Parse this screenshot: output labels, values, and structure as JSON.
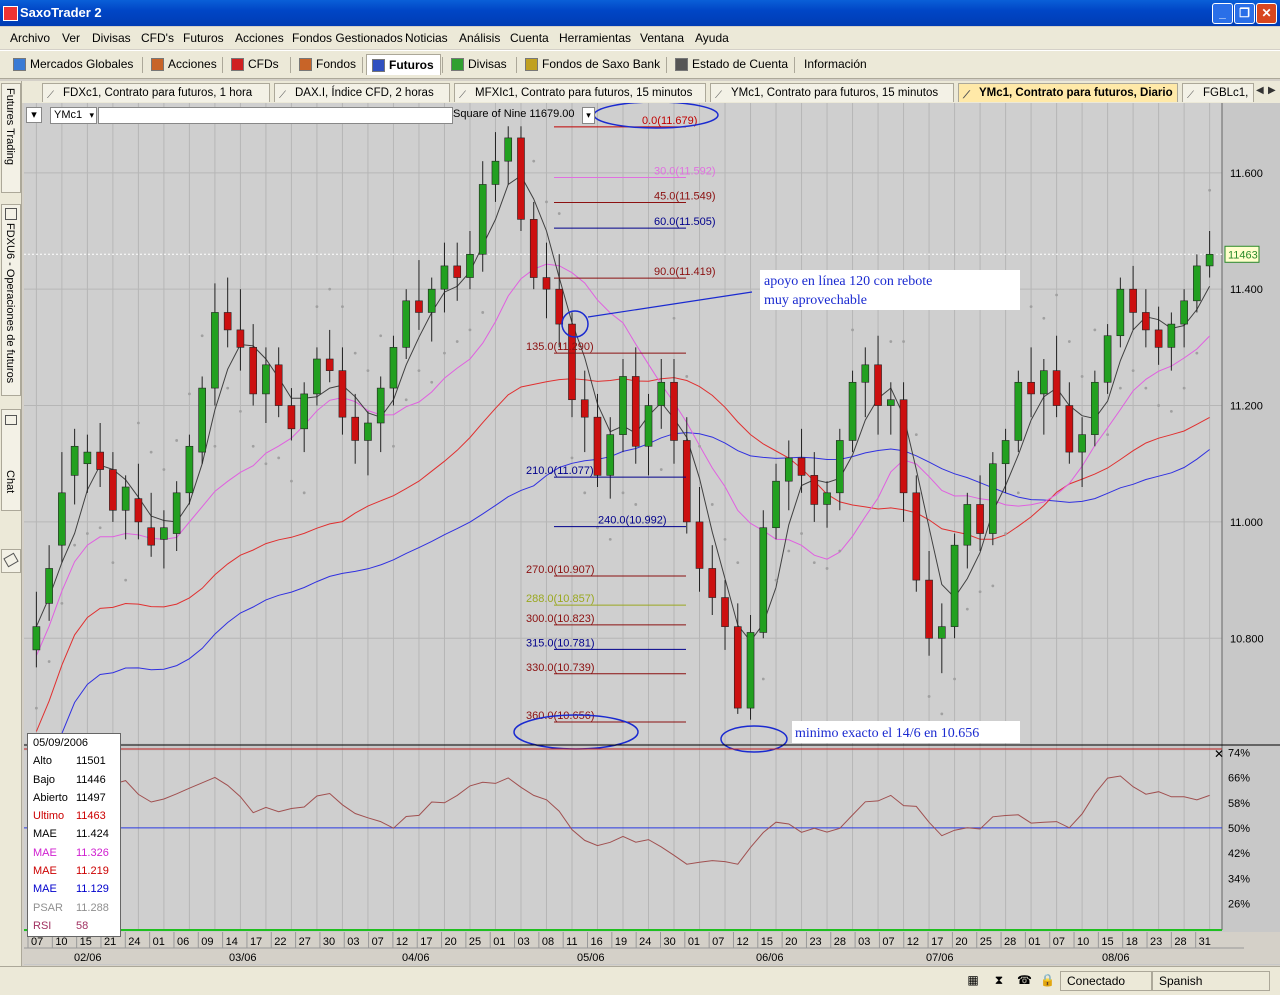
{
  "window": {
    "title": "SaxoTrader 2",
    "min_symbol": "_",
    "max_symbol": "❐",
    "close_symbol": "✕"
  },
  "menu": [
    "Archivo",
    "Ver",
    "Divisas",
    "CFD's",
    "Futuros",
    "Acciones",
    "Fondos Gestionados",
    "Noticias",
    "Análisis",
    "Cuenta",
    "Herramientas",
    "Ventana",
    "Ayuda"
  ],
  "nav": [
    {
      "label": "Mercados Globales",
      "icon": "globe-icon",
      "active": false
    },
    {
      "label": "Acciones",
      "icon": "stocks-icon",
      "active": false
    },
    {
      "label": "CFDs",
      "icon": "cfd-icon",
      "active": false
    },
    {
      "label": "Fondos",
      "icon": "funds-icon",
      "active": false
    },
    {
      "label": "Futuros",
      "icon": "futures-icon",
      "active": true
    },
    {
      "label": "Divisas",
      "icon": "fx-icon",
      "active": false
    },
    {
      "label": "Fondos de Saxo Bank",
      "icon": "saxo-funds-icon",
      "active": false
    },
    {
      "label": "Estado de Cuenta",
      "icon": "account-icon",
      "active": false
    },
    {
      "label": "Información",
      "icon": "",
      "active": false
    }
  ],
  "tabs": [
    {
      "label": "FDXc1, Contrato para futuros, 1 hora",
      "active": false
    },
    {
      "label": "DAX.I, Índice CFD, 2 horas",
      "active": false
    },
    {
      "label": "MFXIc1, Contrato para futuros, 15 minutos",
      "active": false
    },
    {
      "label": "YMc1, Contrato para futuros, 15 minutos",
      "active": false
    },
    {
      "label": "YMc1, Contrato para futuros, Diario",
      "active": true
    },
    {
      "label": "FGBLc1,",
      "active": false
    }
  ],
  "side_tabs": [
    "Futures Trading",
    "FDXU6 - Operaciones de futuros",
    "Chat"
  ],
  "chart_toolbar": {
    "symbol": "YMc1",
    "indicator": "Square of Nine 11679.00"
  },
  "price_label": "11463",
  "y_axis": [
    "11.600",
    "11.400",
    "11.200",
    "11.000",
    "10.800"
  ],
  "rsi_axis": [
    "74%",
    "66%",
    "58%",
    "50%",
    "42%",
    "34%",
    "26%"
  ],
  "square_levels": [
    {
      "label": "0.0(11.679)",
      "color": "#c00000"
    },
    {
      "label": "30.0(11.592)",
      "color": "#e070e0"
    },
    {
      "label": "45.0(11.549)",
      "color": "#8b1010"
    },
    {
      "label": "60.0(11.505)",
      "color": "#00008b"
    },
    {
      "label": "90.0(11.419)",
      "color": "#8b1010"
    },
    {
      "label": "135.0(11.290)",
      "color": "#8b1010"
    },
    {
      "label": "210.0(11.077)",
      "color": "#00008b"
    },
    {
      "label": "240.0(10.992)",
      "color": "#00008b"
    },
    {
      "label": "270.0(10.907)",
      "color": "#8b1010"
    },
    {
      "label": "288.0(10.857)",
      "color": "#9aa820"
    },
    {
      "label": "300.0(10.823)",
      "color": "#8b1010"
    },
    {
      "label": "315.0(10.781)",
      "color": "#00008b"
    },
    {
      "label": "330.0(10.739)",
      "color": "#8b1010"
    },
    {
      "label": "360.0(10.656)",
      "color": "#8b1010"
    }
  ],
  "annotations": {
    "support": "apoyo en línea 120 con rebote muy aprovechable",
    "minimum": "minimo exacto el 14/6 en 10.656"
  },
  "info": {
    "date": "05/09/2006",
    "rows": [
      {
        "label": "Alto",
        "value": "11501",
        "color": "#000000"
      },
      {
        "label": "Bajo",
        "value": "11446",
        "color": "#000000"
      },
      {
        "label": "Abierto",
        "value": "11497",
        "color": "#000000"
      },
      {
        "label": "Ultimo",
        "value": "11463",
        "color": "#cc0000"
      },
      {
        "label": "MAE",
        "value": "11.424",
        "color": "#000000"
      },
      {
        "label": "MAE",
        "value": "11.326",
        "color": "#d020d0"
      },
      {
        "label": "MAE",
        "value": "11.219",
        "color": "#cc0000"
      },
      {
        "label": "MAE",
        "value": "11.129",
        "color": "#0000cc"
      },
      {
        "label": "PSAR",
        "value": "11.288",
        "color": "#909090"
      },
      {
        "label": "RSI",
        "value": "58",
        "color": "#a03060"
      }
    ]
  },
  "x_days": [
    "07",
    "10",
    "15",
    "21",
    "24",
    "01",
    "06",
    "09",
    "14",
    "17",
    "22",
    "27",
    "30",
    "03",
    "07",
    "12",
    "17",
    "20",
    "25",
    "01",
    "03",
    "08",
    "11",
    "16",
    "19",
    "24",
    "30",
    "01",
    "07",
    "12",
    "15",
    "20",
    "23",
    "28",
    "03",
    "07",
    "12",
    "17",
    "20",
    "25",
    "28",
    "01",
    "07",
    "10",
    "15",
    "18",
    "23",
    "28",
    "31"
  ],
  "x_months": [
    "02/06",
    "03/06",
    "04/06",
    "05/06",
    "06/06",
    "07/06",
    "08/06"
  ],
  "status": {
    "connection": "Conectado",
    "language": "Spanish"
  },
  "colors": {
    "up": "#22a020",
    "down": "#cc1010",
    "ma_fast": "#404040",
    "ma_pink": "#e060e0",
    "ma_red": "#e03030",
    "ma_blue": "#3030e0",
    "psar": "#a0a0a0",
    "rsi": "#a05050"
  },
  "chart_data": {
    "type": "candlestick",
    "title": "YMc1, Contrato para futuros, Diario",
    "ylim": [
      10.62,
      11.72
    ],
    "ohlc": [
      [
        10.78,
        10.88,
        10.75,
        10.82
      ],
      [
        10.86,
        10.96,
        10.83,
        10.92
      ],
      [
        10.96,
        11.12,
        10.93,
        11.05
      ],
      [
        11.08,
        11.16,
        11.03,
        11.13
      ],
      [
        11.1,
        11.15,
        11.05,
        11.12
      ],
      [
        11.12,
        11.17,
        11.06,
        11.09
      ],
      [
        11.09,
        11.12,
        11.0,
        11.02
      ],
      [
        11.02,
        11.08,
        10.97,
        11.06
      ],
      [
        11.04,
        11.1,
        10.97,
        11.0
      ],
      [
        10.99,
        11.05,
        10.94,
        10.96
      ],
      [
        10.97,
        11.02,
        10.92,
        10.99
      ],
      [
        10.98,
        11.07,
        10.95,
        11.05
      ],
      [
        11.05,
        11.15,
        11.03,
        11.13
      ],
      [
        11.12,
        11.25,
        11.1,
        11.23
      ],
      [
        11.23,
        11.41,
        11.2,
        11.36
      ],
      [
        11.36,
        11.42,
        11.3,
        11.33
      ],
      [
        11.33,
        11.4,
        11.26,
        11.3
      ],
      [
        11.3,
        11.34,
        11.2,
        11.22
      ],
      [
        11.22,
        11.3,
        11.17,
        11.27
      ],
      [
        11.27,
        11.3,
        11.18,
        11.2
      ],
      [
        11.2,
        11.23,
        11.14,
        11.16
      ],
      [
        11.16,
        11.24,
        11.12,
        11.22
      ],
      [
        11.22,
        11.3,
        11.2,
        11.28
      ],
      [
        11.28,
        11.33,
        11.24,
        11.26
      ],
      [
        11.26,
        11.3,
        11.15,
        11.18
      ],
      [
        11.18,
        11.22,
        11.1,
        11.14
      ],
      [
        11.14,
        11.19,
        11.08,
        11.17
      ],
      [
        11.17,
        11.25,
        11.12,
        11.23
      ],
      [
        11.23,
        11.32,
        11.2,
        11.3
      ],
      [
        11.3,
        11.4,
        11.28,
        11.38
      ],
      [
        11.38,
        11.45,
        11.33,
        11.36
      ],
      [
        11.36,
        11.42,
        11.31,
        11.4
      ],
      [
        11.4,
        11.48,
        11.36,
        11.44
      ],
      [
        11.44,
        11.48,
        11.38,
        11.42
      ],
      [
        11.42,
        11.5,
        11.4,
        11.46
      ],
      [
        11.46,
        11.62,
        11.43,
        11.58
      ],
      [
        11.58,
        11.67,
        11.55,
        11.62
      ],
      [
        11.62,
        11.68,
        11.58,
        11.66
      ],
      [
        11.66,
        11.68,
        11.5,
        11.52
      ],
      [
        11.52,
        11.55,
        11.4,
        11.42
      ],
      [
        11.42,
        11.48,
        11.35,
        11.4
      ],
      [
        11.4,
        11.46,
        11.3,
        11.34
      ],
      [
        11.34,
        11.36,
        11.18,
        11.21
      ],
      [
        11.21,
        11.26,
        11.12,
        11.18
      ],
      [
        11.18,
        11.22,
        11.06,
        11.08
      ],
      [
        11.08,
        11.18,
        11.04,
        11.15
      ],
      [
        11.15,
        11.28,
        11.12,
        11.25
      ],
      [
        11.25,
        11.3,
        11.1,
        11.13
      ],
      [
        11.13,
        11.22,
        11.08,
        11.2
      ],
      [
        11.2,
        11.28,
        11.16,
        11.24
      ],
      [
        11.24,
        11.28,
        11.1,
        11.14
      ],
      [
        11.14,
        11.18,
        10.98,
        11.0
      ],
      [
        11.0,
        11.06,
        10.88,
        10.92
      ],
      [
        10.92,
        10.96,
        10.84,
        10.87
      ],
      [
        10.87,
        10.9,
        10.78,
        10.82
      ],
      [
        10.82,
        10.86,
        10.67,
        10.68
      ],
      [
        10.68,
        10.84,
        10.66,
        10.81
      ],
      [
        10.81,
        11.02,
        10.8,
        10.99
      ],
      [
        10.99,
        11.1,
        10.97,
        11.07
      ],
      [
        11.07,
        11.14,
        11.02,
        11.11
      ],
      [
        11.11,
        11.16,
        11.05,
        11.08
      ],
      [
        11.08,
        11.12,
        11.0,
        11.03
      ],
      [
        11.03,
        11.07,
        10.99,
        11.05
      ],
      [
        11.05,
        11.16,
        11.02,
        11.14
      ],
      [
        11.14,
        11.26,
        11.12,
        11.24
      ],
      [
        11.24,
        11.3,
        11.18,
        11.27
      ],
      [
        11.27,
        11.32,
        11.15,
        11.2
      ],
      [
        11.2,
        11.24,
        11.15,
        11.21
      ],
      [
        11.21,
        11.24,
        11.0,
        11.05
      ],
      [
        11.05,
        11.08,
        10.88,
        10.9
      ],
      [
        10.9,
        10.95,
        10.77,
        10.8
      ],
      [
        10.8,
        10.86,
        10.74,
        10.82
      ],
      [
        10.82,
        10.98,
        10.8,
        10.96
      ],
      [
        10.96,
        11.05,
        10.92,
        11.03
      ],
      [
        11.03,
        11.08,
        10.95,
        10.98
      ],
      [
        10.98,
        11.12,
        10.96,
        11.1
      ],
      [
        11.1,
        11.16,
        11.05,
        11.14
      ],
      [
        11.14,
        11.26,
        11.12,
        11.24
      ],
      [
        11.24,
        11.3,
        11.18,
        11.22
      ],
      [
        11.22,
        11.28,
        11.15,
        11.26
      ],
      [
        11.26,
        11.32,
        11.18,
        11.2
      ],
      [
        11.2,
        11.24,
        11.1,
        11.12
      ],
      [
        11.12,
        11.18,
        11.06,
        11.15
      ],
      [
        11.15,
        11.26,
        11.13,
        11.24
      ],
      [
        11.24,
        11.34,
        11.22,
        11.32
      ],
      [
        11.32,
        11.42,
        11.3,
        11.4
      ],
      [
        11.4,
        11.44,
        11.33,
        11.36
      ],
      [
        11.36,
        11.4,
        11.3,
        11.33
      ],
      [
        11.33,
        11.37,
        11.27,
        11.3
      ],
      [
        11.3,
        11.36,
        11.26,
        11.34
      ],
      [
        11.34,
        11.4,
        11.3,
        11.38
      ],
      [
        11.38,
        11.46,
        11.36,
        11.44
      ],
      [
        11.44,
        11.5,
        11.42,
        11.46
      ]
    ],
    "series": [
      {
        "name": "MAE",
        "color": "#404040"
      },
      {
        "name": "MAE",
        "color": "#e060e0"
      },
      {
        "name": "MAE",
        "color": "#e03030"
      },
      {
        "name": "MAE",
        "color": "#3030e0"
      },
      {
        "name": "PSAR",
        "color": "#a0a0a0"
      },
      {
        "name": "RSI",
        "color": "#a05050"
      }
    ]
  }
}
